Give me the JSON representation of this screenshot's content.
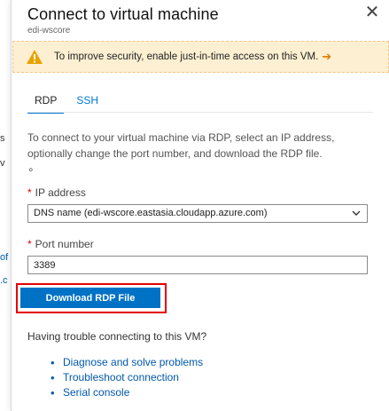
{
  "window": {
    "title": "Connect to virtual machine",
    "subtitle": "edi-wscore",
    "close_glyph": "✕"
  },
  "warning": {
    "text": "To improve security, enable just-in-time access on this VM.",
    "arrow": "➔",
    "color": "#fdf0d2"
  },
  "tabs": [
    {
      "label": "RDP",
      "active": true
    },
    {
      "label": "SSH",
      "active": false
    }
  ],
  "description": "To connect to your virtual machine via RDP, select an IP address, optionally change the port number, and download the RDP file.",
  "description_tail": "∘",
  "ip_field": {
    "required_mark": "*",
    "label": "IP address",
    "value": "DNS name (edi-wscore.eastasia.cloudapp.azure.com)"
  },
  "port_field": {
    "required_mark": "*",
    "label": "Port number",
    "value": "3389"
  },
  "download_button": {
    "label": "Download RDP File",
    "color": "#0072c6",
    "highlight_color": "#e50000"
  },
  "trouble": {
    "heading": "Having trouble connecting to this VM?",
    "links": [
      "Diagnose and solve problems",
      "Troubleshoot connection",
      "Serial console"
    ]
  },
  "background_fragments": {
    "items": [
      "s",
      "v",
      "of",
      ".c"
    ]
  }
}
